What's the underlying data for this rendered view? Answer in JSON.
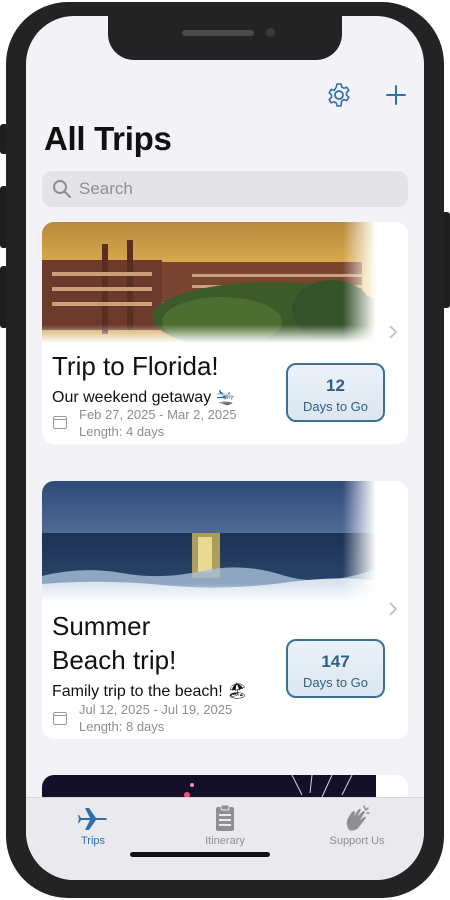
{
  "header": {
    "settings_icon": "gear-icon",
    "add_icon": "plus-icon",
    "title": "All Trips"
  },
  "search": {
    "placeholder": "Search"
  },
  "trips": [
    {
      "title": "Trip to Florida!",
      "subtitle": "Our weekend getaway 🛬",
      "dates": "Feb 27, 2025 - Mar 2, 2025",
      "length": "Length: 4 days",
      "count": "12",
      "count_label": "Days to Go"
    },
    {
      "title_line1": "Summer",
      "title_line2": "Beach trip!",
      "subtitle": "Family trip to the beach! 🏖",
      "dates": "Jul 12, 2025 - Jul 19, 2025",
      "length": "Length: 8 days",
      "count": "147",
      "count_label": "Days to Go"
    }
  ],
  "tabs": [
    {
      "label": "Trips",
      "icon": "airplane-icon",
      "active": true
    },
    {
      "label": "Itinerary",
      "icon": "clipboard-icon",
      "active": false
    },
    {
      "label": "Support Us",
      "icon": "clapping-hands-icon",
      "active": false
    }
  ],
  "colors": {
    "accent": "#2f6fb0",
    "background": "#f2f2f7",
    "count_border": "#3e6f96"
  }
}
